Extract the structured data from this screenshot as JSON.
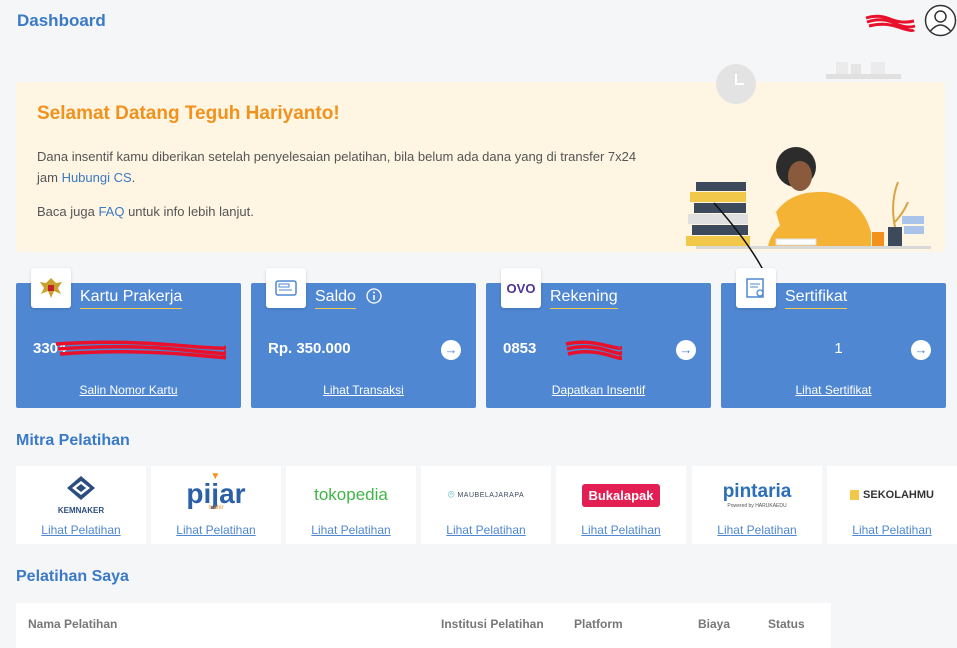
{
  "header": {
    "title": "Dashboard"
  },
  "banner": {
    "greeting": "Selamat Datang Teguh Hariyanto!",
    "desc_pre": "Dana insentif kamu diberikan setelah penyelesaian pelatihan, bila belum ada dana yang di transfer 7x24 jam ",
    "desc_link": "Hubungi CS",
    "desc_post": ".",
    "faq_pre": "Baca juga ",
    "faq_link": "FAQ",
    "faq_post": " untuk info lebih lanjut."
  },
  "cards": [
    {
      "title": "Kartu Prakerja",
      "value": "3304",
      "link": "Salin Nomor Kartu"
    },
    {
      "title": "Saldo",
      "value": "Rp. 350.000",
      "link": "Lihat Transaksi"
    },
    {
      "title": "Rekening",
      "value": "0853",
      "link": "Dapatkan Insentif",
      "icon_text": "OVO"
    },
    {
      "title": "Sertifikat",
      "value": "1",
      "link": "Lihat Sertifikat"
    }
  ],
  "mitra": {
    "title": "Mitra Pelatihan",
    "partners": [
      {
        "name": "KEMNAKER",
        "link": "Lihat Pelatihan"
      },
      {
        "name": "pijar",
        "sub": "mahir",
        "link": "Lihat Pelatihan"
      },
      {
        "name": "tokopedia",
        "link": "Lihat Pelatihan"
      },
      {
        "name": "MAUBELAJARAPA",
        "link": "Lihat Pelatihan"
      },
      {
        "name": "Bukalapak",
        "link": "Lihat Pelatihan"
      },
      {
        "name": "pintaria",
        "sub": "Powered by HARUKAEDU",
        "link": "Lihat Pelatihan"
      },
      {
        "name": "SEKOLAHMU",
        "link": "Lihat Pelatihan"
      }
    ]
  },
  "pelatihan": {
    "title": "Pelatihan Saya",
    "columns": [
      "Nama Pelatihan",
      "Institusi Pelatihan",
      "Platform",
      "Biaya",
      "Status"
    ]
  },
  "colors": {
    "primary": "#4f87d2",
    "accent": "#f2921d",
    "banner_bg": "#fef5e3",
    "redaction": "#e8102a"
  }
}
